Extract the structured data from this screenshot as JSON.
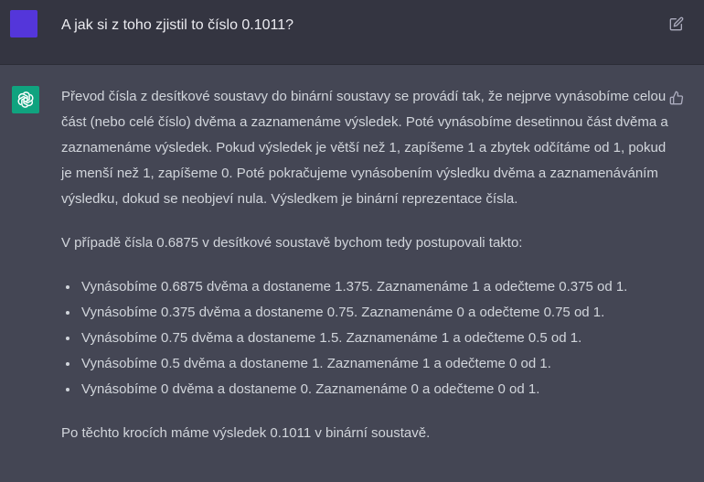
{
  "user_message": {
    "text": "A jak si z toho zjistil to číslo 0.1011?"
  },
  "assistant_message": {
    "paragraph_1": "Převod čísla z desítkové soustavy do binární soustavy se provádí tak, že nejprve vynásobíme celou část (nebo celé číslo) dvěma a zaznamenáme výsledek. Poté vynásobíme desetinnou část dvěma a zaznamenáme výsledek. Pokud výsledek je větší než 1, zapíšeme 1 a zbytek odčítáme od 1, pokud je menší než 1, zapíšeme 0. Poté pokračujeme vynásobením výsledku dvěma a zaznamenáváním výsledku, dokud se neobjeví nula. Výsledkem je binární reprezentace čísla.",
    "paragraph_2": "V případě čísla 0.6875 v desítkové soustavě bychom tedy postupovali takto:",
    "steps": [
      "Vynásobíme 0.6875 dvěma a dostaneme 1.375. Zaznamenáme 1 a odečteme 0.375 od 1.",
      "Vynásobíme 0.375 dvěma a dostaneme 0.75. Zaznamenáme 0 a odečteme 0.75 od 1.",
      "Vynásobíme 0.75 dvěma a dostaneme 1.5. Zaznamenáme 1 a odečteme 0.5 od 1.",
      "Vynásobíme 0.5 dvěma a dostaneme 1. Zaznamenáme 1 a odečteme 0 od 1.",
      "Vynásobíme 0 dvěma a dostaneme 0. Zaznamenáme 0 a odečteme 0 od 1."
    ],
    "paragraph_3": "Po těchto krocích máme výsledek 0.1011 v binární soustavě."
  },
  "icons": {
    "user_avatar": "user-avatar",
    "edit": "pencil-edit-icon",
    "assistant_logo": "openai-logo-icon",
    "thumbs_up": "thumbs-up-icon"
  },
  "colors": {
    "user_bg": "#343541",
    "assistant_bg": "#444654",
    "user_avatar": "#5436da",
    "assistant_avatar": "#10a37f",
    "text": "#d1d5db"
  }
}
